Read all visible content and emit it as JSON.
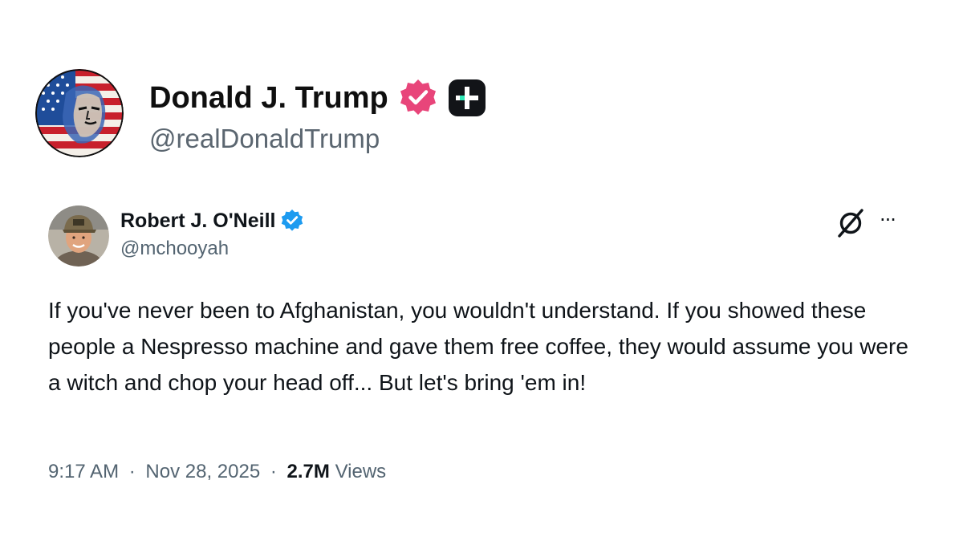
{
  "outer_post": {
    "display_name": "Donald J. Trump",
    "handle": "@realDonaldTrump",
    "avatar_icon": "flag-portrait-avatar",
    "verified_icon": "verified-badge-icon",
    "plus_icon": "plus-badge-icon",
    "colors": {
      "verified_badge": "#e8457a",
      "plus_badge": "#121418",
      "plus_badge_accent": "#2ee8b6",
      "handle_text": "#5b6670"
    }
  },
  "embedded_tweet": {
    "display_name": "Robert J. O'Neill",
    "handle": "@mchooyah",
    "avatar_icon": "man-in-cap-avatar",
    "verified_icon": "verified-badge-icon",
    "grok_icon": "grok-icon",
    "more_icon": "more-options-icon",
    "more_glyph": "···",
    "body": "If you've never been to Afghanistan, you wouldn't understand. If you showed these people a Nespresso machine and gave them free coffee, they would assume you were a witch and chop your head off... But let's bring 'em in!",
    "time": "9:17 AM",
    "separator": "·",
    "date": "Nov 28, 2025",
    "views_count": "2.7M",
    "views_label": "Views",
    "colors": {
      "verified_badge": "#1d9bf0",
      "secondary_text": "#536471",
      "primary_text": "#0f1419"
    }
  }
}
